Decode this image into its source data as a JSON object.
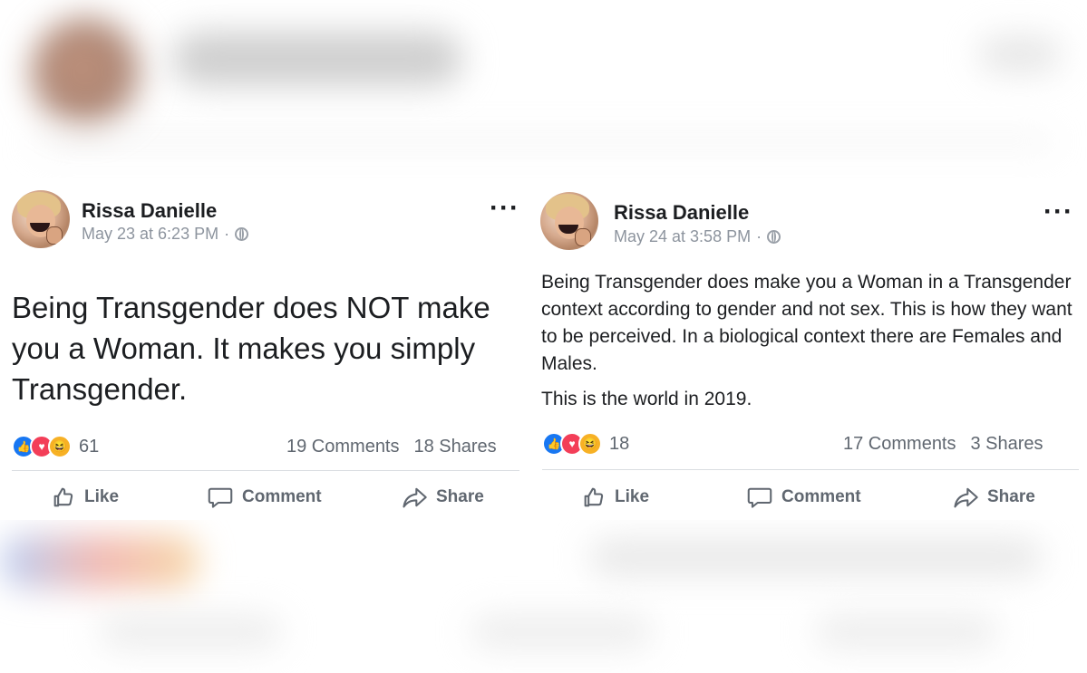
{
  "posts": [
    {
      "author": "Rissa Danielle",
      "timestamp": "May 23 at 6:23 PM",
      "privacy_sep": "·",
      "text": "Being Transgender does NOT make you a Woman. It makes you simply Transgender.",
      "reaction_count": "61",
      "comments": "19 Comments",
      "shares": "18 Shares",
      "actions": {
        "like": "Like",
        "comment": "Comment",
        "share": "Share"
      }
    },
    {
      "author": "Rissa Danielle",
      "timestamp": "May 24 at 3:58 PM",
      "privacy_sep": "·",
      "text_p1": "Being Transgender does make you a Woman in a Transgender context according to gender and not sex. This is how they want to be perceived. In a biological context there are Females and Males.",
      "text_p2": "This is the world in 2019.",
      "reaction_count": "18",
      "comments": "17 Comments",
      "shares": "3 Shares",
      "actions": {
        "like": "Like",
        "comment": "Comment",
        "share": "Share"
      }
    }
  ],
  "icons": {
    "reactions": [
      "like-reaction-icon",
      "love-reaction-icon",
      "haha-reaction-icon"
    ],
    "privacy": "globe-icon",
    "menu": "more-options-icon"
  },
  "colors": {
    "like": "#1877f2",
    "love": "#f33e58",
    "haha": "#f7b125",
    "secondary_text": "#606770"
  }
}
